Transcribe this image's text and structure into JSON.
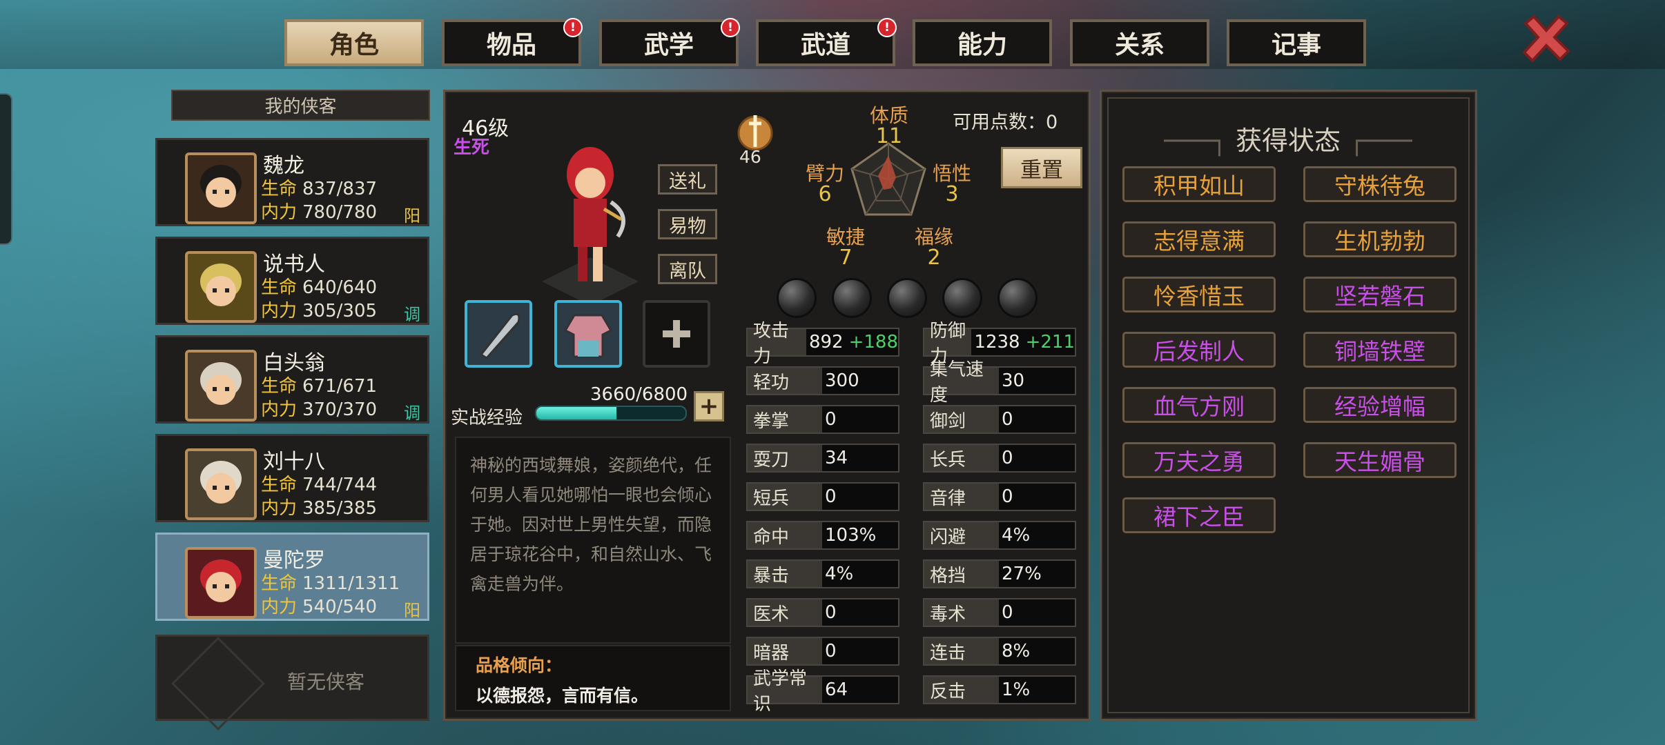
{
  "tabs": [
    {
      "label": "角色",
      "active": true,
      "badge": false
    },
    {
      "label": "物品",
      "active": false,
      "badge": true
    },
    {
      "label": "武学",
      "active": false,
      "badge": true
    },
    {
      "label": "武道",
      "active": false,
      "badge": true
    },
    {
      "label": "能力",
      "active": false,
      "badge": false
    },
    {
      "label": "关系",
      "active": false,
      "badge": false
    },
    {
      "label": "记事",
      "active": false,
      "badge": false
    }
  ],
  "badge_text": "!",
  "roster": {
    "title": "我的侠客",
    "hp_label": "生命",
    "mp_label": "内力",
    "members": [
      {
        "name": "魏龙",
        "hp": "837/837",
        "mp": "780/780",
        "tag": "阳",
        "tag_color": "#e9c547"
      },
      {
        "name": "说书人",
        "hp": "640/640",
        "mp": "305/305",
        "tag": "调",
        "tag_color": "#3fc3a0"
      },
      {
        "name": "白头翁",
        "hp": "671/671",
        "mp": "370/370",
        "tag": "调",
        "tag_color": "#3fc3a0"
      },
      {
        "name": "刘十八",
        "hp": "744/744",
        "mp": "385/385",
        "tag": "",
        "tag_color": "#e9c547"
      },
      {
        "name": "曼陀罗",
        "hp": "1311/1311",
        "mp": "540/540",
        "tag": "阳",
        "tag_color": "#e9c547"
      }
    ],
    "empty_label": "暂无侠客"
  },
  "character": {
    "level": "46级",
    "trait": "生死",
    "buttons": {
      "gift": "送礼",
      "trade": "易物",
      "leave": "离队"
    },
    "rank_value": "46",
    "exp_label": "实战经验",
    "exp_text": "3660/6800",
    "exp_progress": 0.538,
    "bio": "神秘的西域舞娘，姿颜绝代，任何男人看见她哪怕一眼也会倾心于她。因对世上男性失望，而隐居于琼花谷中，和自然山水、飞禽走兽为伴。",
    "morality_label": "品格倾向：",
    "morality_text": "以德报怨，言而有信。"
  },
  "attributes": {
    "available_points": "可用点数：0",
    "reset": "重置",
    "tizhi": {
      "label": "体质",
      "value": "11"
    },
    "bili": {
      "label": "臂力",
      "value": "6"
    },
    "wuxing": {
      "label": "悟性",
      "value": "3"
    },
    "minjie": {
      "label": "敏捷",
      "value": "7"
    },
    "fuyuan": {
      "label": "福缘",
      "value": "2"
    }
  },
  "stats_left": [
    {
      "k": "攻击力",
      "v": "892",
      "b": "+188"
    },
    {
      "k": "轻功",
      "v": "300",
      "b": ""
    },
    {
      "k": "拳掌",
      "v": "0",
      "b": ""
    },
    {
      "k": "耍刀",
      "v": "34",
      "b": ""
    },
    {
      "k": "短兵",
      "v": "0",
      "b": ""
    },
    {
      "k": "命中",
      "v": "103%",
      "b": ""
    },
    {
      "k": "暴击",
      "v": "4%",
      "b": ""
    },
    {
      "k": "医术",
      "v": "0",
      "b": ""
    },
    {
      "k": "暗器",
      "v": "0",
      "b": ""
    },
    {
      "k": "武学常识",
      "v": "64",
      "b": ""
    }
  ],
  "stats_right": [
    {
      "k": "防御力",
      "v": "1238",
      "b": "+211"
    },
    {
      "k": "集气速度",
      "v": "30",
      "b": ""
    },
    {
      "k": "御剑",
      "v": "0",
      "b": ""
    },
    {
      "k": "长兵",
      "v": "0",
      "b": ""
    },
    {
      "k": "音律",
      "v": "0",
      "b": ""
    },
    {
      "k": "闪避",
      "v": "4%",
      "b": ""
    },
    {
      "k": "格挡",
      "v": "27%",
      "b": ""
    },
    {
      "k": "毒术",
      "v": "0",
      "b": ""
    },
    {
      "k": "连击",
      "v": "8%",
      "b": ""
    },
    {
      "k": "反击",
      "v": "1%",
      "b": ""
    }
  ],
  "status_panel": {
    "title": "获得状态",
    "states": [
      {
        "label": "积甲如山",
        "color": "#e8a23a"
      },
      {
        "label": "守株待兔",
        "color": "#e8a23a"
      },
      {
        "label": "志得意满",
        "color": "#e8a23a"
      },
      {
        "label": "生机勃勃",
        "color": "#e8a23a"
      },
      {
        "label": "怜香惜玉",
        "color": "#e8a23a"
      },
      {
        "label": "坚若磐石",
        "color": "#c84fe8"
      },
      {
        "label": "后发制人",
        "color": "#c84fe8"
      },
      {
        "label": "铜墙铁壁",
        "color": "#c84fe8"
      },
      {
        "label": "血气方刚",
        "color": "#c84fe8"
      },
      {
        "label": "经验增幅",
        "color": "#c84fe8"
      },
      {
        "label": "万夫之勇",
        "color": "#c84fe8"
      },
      {
        "label": "天生媚骨",
        "color": "#c84fe8"
      },
      {
        "label": "裙下之臣",
        "color": "#c84fe8"
      }
    ]
  },
  "colors": {
    "gold": "#e9c547",
    "orange": "#e6a04f",
    "purple": "#c84fe8",
    "green": "#4fd16a",
    "teal": "#3fc3a0",
    "close_red": "#d24a4a"
  }
}
